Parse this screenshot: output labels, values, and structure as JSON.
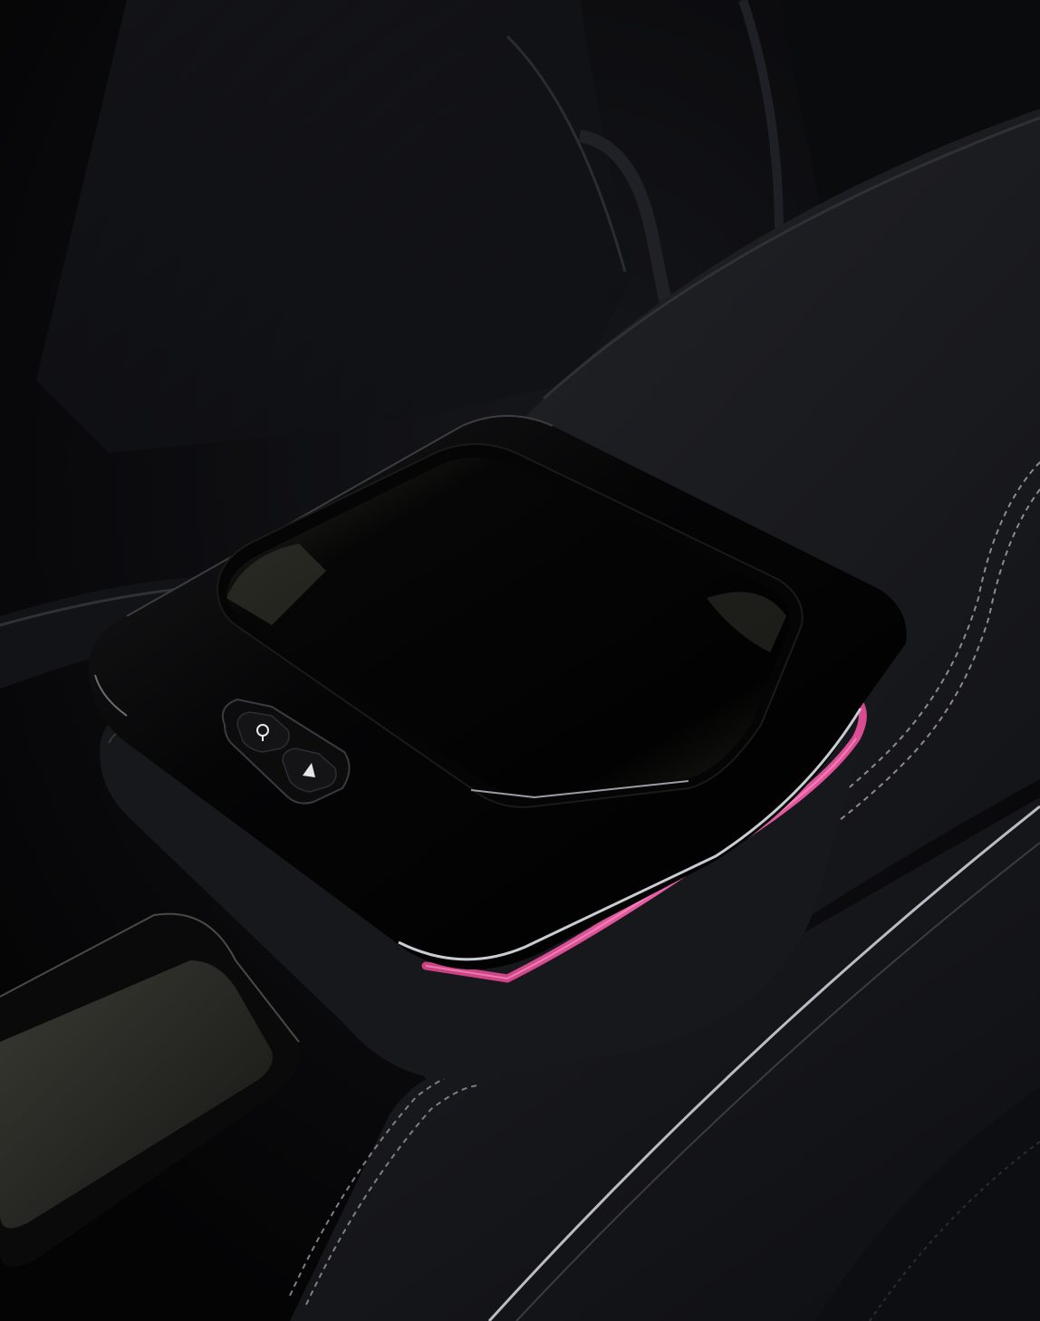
{
  "image": {
    "subject": "",
    "palette": {
      "background": "#060608",
      "leather": "#1a1b1f",
      "leather_highlight": "#2a2b31",
      "stitching": "#8a8a90",
      "glass": "#030304",
      "ambient_light": "#e0529c",
      "trim_silver": "#b9bcc4"
    },
    "buttons": [
      {
        "icon": "mic-icon"
      },
      {
        "icon": "navigation-arrow-icon"
      }
    ]
  }
}
